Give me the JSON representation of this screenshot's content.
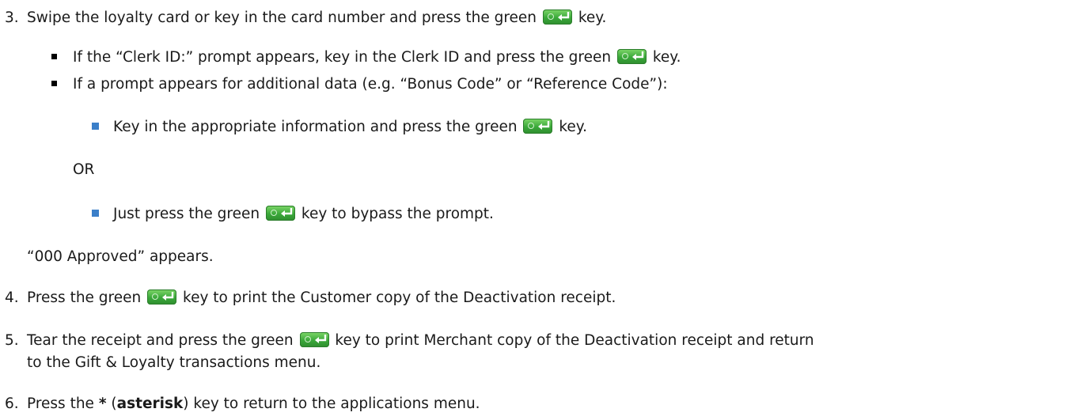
{
  "step3": {
    "number": "3.",
    "text_before": "Swipe the loyalty card or key in the card number and press the green",
    "text_after": "key.",
    "bullets": [
      {
        "text_before": "If the “Clerk ID:” prompt appears, key in the Clerk ID and press the green",
        "text_after": "key."
      },
      {
        "text": "If a prompt appears for additional data (e.g. “Bonus Code” or “Reference Code”):"
      }
    ],
    "sub_a": {
      "text_before": "Key in the appropriate information and press the green",
      "text_after": "key."
    },
    "or_label": "OR",
    "sub_b": {
      "text_before": "Just press the green",
      "text_after": "key to bypass the prompt."
    },
    "result": "“000 Approved” appears."
  },
  "step4": {
    "number": "4.",
    "text_before": "Press the green",
    "text_after": "key to print the Customer copy of the Deactivation receipt."
  },
  "step5": {
    "number": "5.",
    "text_before": "Tear the receipt and press the green",
    "text_after": "key to print Merchant copy of the Deactivation receipt and return",
    "text_line2": "to the Gift & Loyalty transactions menu."
  },
  "step6": {
    "number": "6.",
    "text_before": "Press the",
    "key_symbol": "*",
    "paren_open": "(",
    "key_name": "asterisk",
    "text_after": ") key to return to the applications menu."
  },
  "icons": {
    "enter_key": "green-enter-key-icon"
  },
  "colors": {
    "key_green": "#3aa83a",
    "sub_bullet": "#3b7fc9"
  }
}
